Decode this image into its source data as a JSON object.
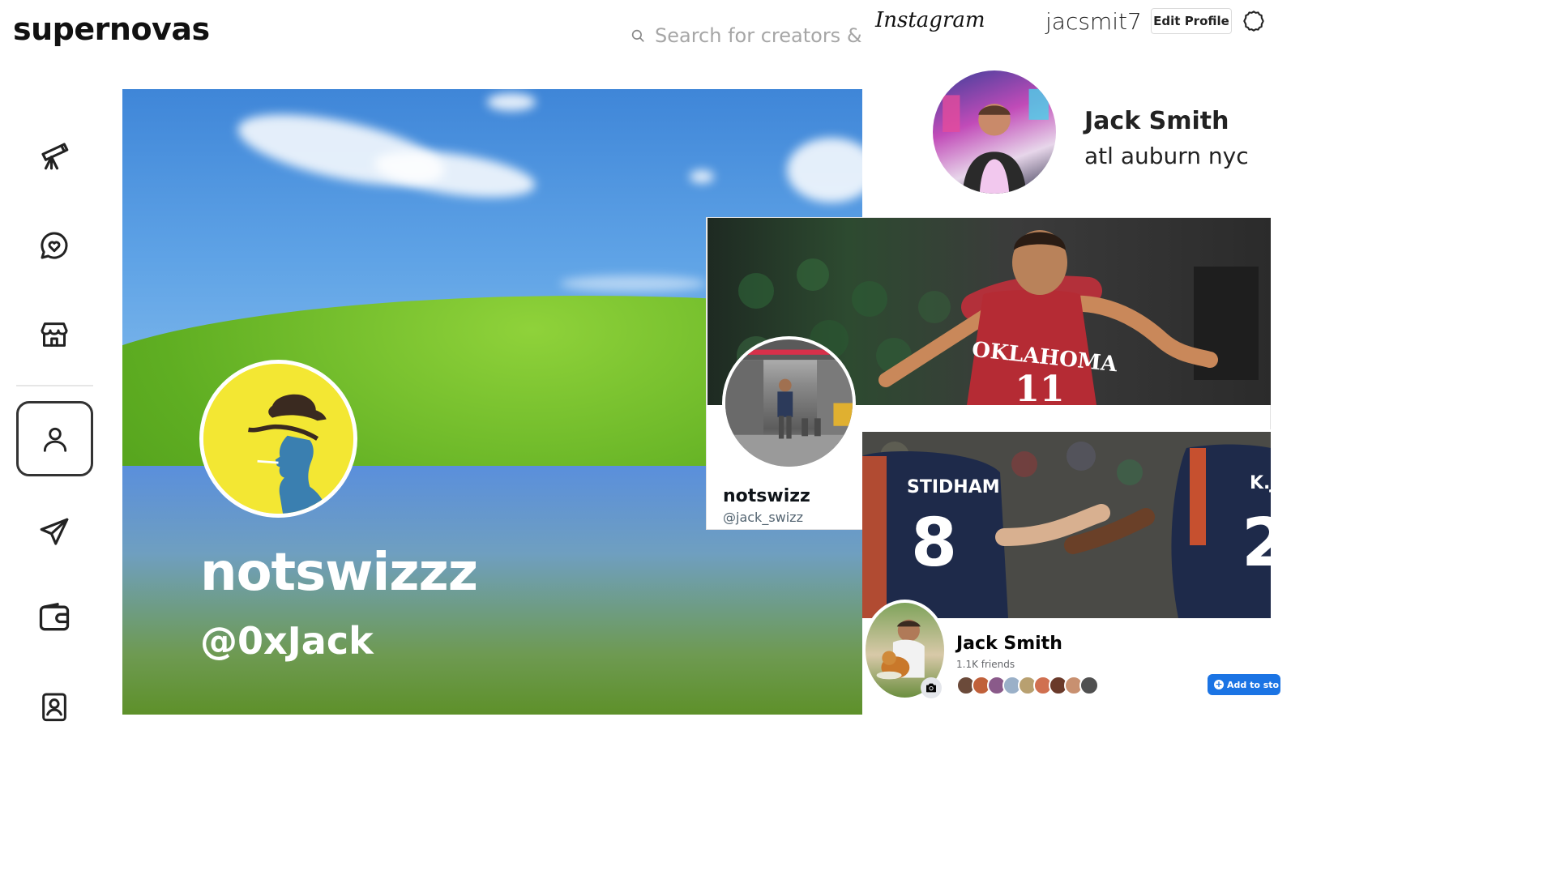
{
  "supernovas": {
    "logo": "supernovas",
    "search_placeholder": "Search for creators &",
    "sidebar": [
      {
        "name": "explore",
        "icon": "telescope-icon"
      },
      {
        "name": "messages",
        "icon": "heart-chat-icon"
      },
      {
        "name": "store",
        "icon": "storefront-icon"
      },
      {
        "name": "profile",
        "icon": "user-icon",
        "active": true
      },
      {
        "name": "send",
        "icon": "paper-plane-icon"
      },
      {
        "name": "wallet",
        "icon": "wallet-icon"
      },
      {
        "name": "contacts",
        "icon": "contact-card-icon"
      }
    ],
    "profile": {
      "display_name": "notswizzz",
      "handle": "@0xJack"
    }
  },
  "instagram": {
    "logo": "Instagram",
    "username": "jacsmit7",
    "edit_profile_label": "Edit Profile",
    "full_name": "Jack Smith",
    "bio": "atl auburn nyc"
  },
  "twitter": {
    "display_name": "notswizz",
    "handle": "@jack_swizz",
    "banner_jersey_text": "OKLAHOMA",
    "banner_jersey_number": "11"
  },
  "facebook": {
    "name": "Jack Smith",
    "friends_count": "1.1K friends",
    "add_story_label": "Add to sto",
    "banner_jersey_left": "STIDHAM",
    "banner_jersey_left_number": "8",
    "banner_jersey_right": "K.J",
    "banner_jersey_right_number": "2",
    "friend_avatar_colors": [
      "#6b4a3a",
      "#c0603a",
      "#8a5a8a",
      "#9ab0c8",
      "#b8a070",
      "#d07050",
      "#6a3a2a",
      "#c89070",
      "#505050"
    ]
  },
  "colors": {
    "fb_blue": "#1b74e4",
    "sn_text": "#111111"
  }
}
